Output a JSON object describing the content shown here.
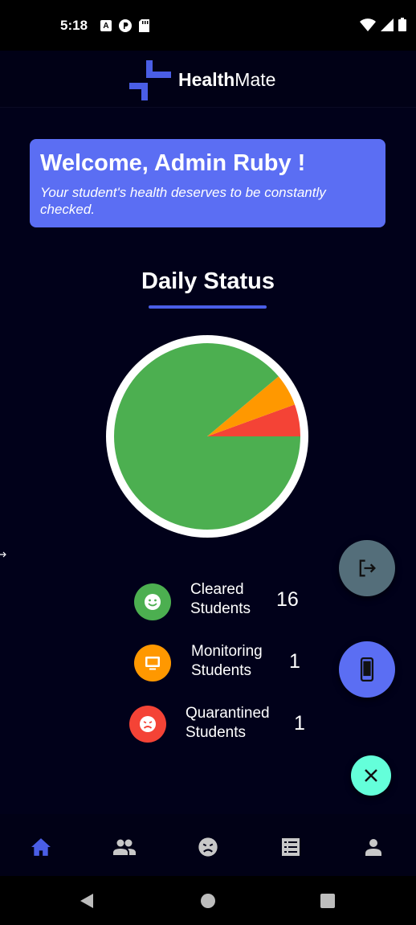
{
  "status_bar": {
    "time": "5:18",
    "left_icons": [
      "a-icon",
      "p-icon",
      "sd-card-icon"
    ],
    "right_icons": [
      "wifi-icon",
      "signal-icon",
      "battery-icon"
    ]
  },
  "app": {
    "brand_bold": "Health",
    "brand_regular": "Mate",
    "accent": "#4a5ee6"
  },
  "welcome": {
    "title": "Welcome, Admin Ruby !",
    "subtitle": "Your student's health deserves to be constantly checked."
  },
  "daily_status": {
    "title": "Daily Status"
  },
  "chart_data": {
    "type": "pie",
    "title": "Daily Status",
    "slices": [
      {
        "label": "Cleared Students",
        "value": 16,
        "color": "#4caf50"
      },
      {
        "label": "Monitoring Students",
        "value": 1,
        "color": "#ff9800"
      },
      {
        "label": "Quarantined Students",
        "value": 1,
        "color": "#f44336"
      }
    ]
  },
  "stats": [
    {
      "label_line1": "Cleared",
      "label_line2": "Students",
      "value": "16",
      "icon": "smiley-icon",
      "color": "#4caf50"
    },
    {
      "label_line1": "Monitoring",
      "label_line2": "Students",
      "value": "1",
      "icon": "monitor-icon",
      "color": "#ff9800"
    },
    {
      "label_line1": "Quarantined",
      "label_line2": "Students",
      "value": "1",
      "icon": "sick-face-icon",
      "color": "#f44336"
    }
  ],
  "fabs": {
    "logout": {
      "icon": "logout-icon",
      "color": "#546e7a"
    },
    "device": {
      "icon": "phone-icon",
      "color": "#5b6ef3"
    },
    "close": {
      "icon": "close-icon",
      "color": "#64ffda"
    }
  },
  "bottom_nav": {
    "items": [
      {
        "icon": "home-icon",
        "active": true
      },
      {
        "icon": "people-icon",
        "active": false
      },
      {
        "icon": "sick-face-icon",
        "active": false
      },
      {
        "icon": "list-icon",
        "active": false
      },
      {
        "icon": "person-icon",
        "active": false
      }
    ],
    "active_color": "#4a5ee6",
    "inactive_color": "#c8c8c8"
  },
  "system_nav": [
    "back-icon",
    "home-circle-icon",
    "recents-icon"
  ]
}
